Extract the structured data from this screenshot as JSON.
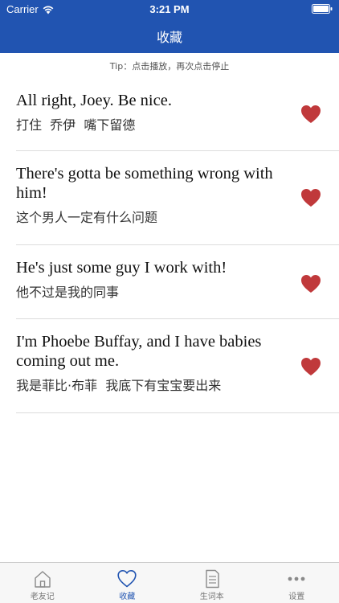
{
  "status_bar": {
    "carrier": "Carrier",
    "time": "3:21 PM",
    "wifi_icon": "wifi-icon",
    "battery_icon": "battery-icon"
  },
  "nav": {
    "title": "收藏"
  },
  "tip": "Tip：点击播放，再次点击停止",
  "items": [
    {
      "english": "All right, Joey. Be nice.",
      "chinese": "打住  乔伊  嘴下留德",
      "icon": "heart-icon"
    },
    {
      "english": "There's gotta be something wrong with him!",
      "chinese": "这个男人一定有什么问题",
      "icon": "heart-icon"
    },
    {
      "english": "He's just some guy I work with!",
      "chinese": "他不过是我的同事",
      "icon": "heart-icon"
    },
    {
      "english": "I'm Phoebe Buffay, and I have babies coming out me.",
      "chinese": "我是菲比·布菲  我底下有宝宝要出来",
      "icon": "heart-icon"
    }
  ],
  "tabs": [
    {
      "label": "老友记",
      "icon": "home-icon"
    },
    {
      "label": "收藏",
      "icon": "heart-outline-icon",
      "active": true
    },
    {
      "label": "生词本",
      "icon": "notebook-icon"
    },
    {
      "label": "设置",
      "icon": "more-icon"
    }
  ],
  "colors": {
    "header": "#2154b1",
    "heart": "#c0393b",
    "active_tab": "#2154b1",
    "inactive_tab": "#777777"
  }
}
